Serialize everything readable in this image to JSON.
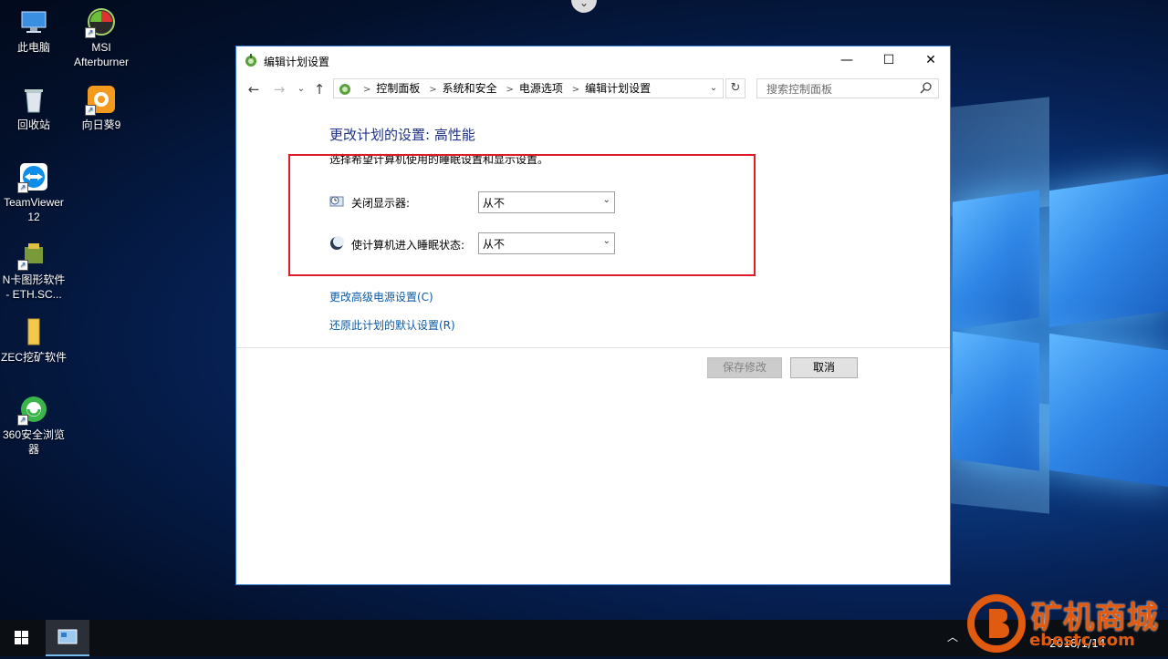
{
  "desktop": {
    "icons": [
      {
        "label": "此电脑"
      },
      {
        "label": "MSI Afterburner"
      },
      {
        "label": "回收站"
      },
      {
        "label": "向日葵9"
      },
      {
        "label": "TeamViewer 12"
      },
      {
        "label": "N卡图形软件 - ETH.SC..."
      },
      {
        "label": "ZEC挖矿软件"
      },
      {
        "label": "360安全浏览器"
      }
    ]
  },
  "window": {
    "title": "编辑计划设置",
    "controls": {
      "minimize": "—",
      "maximize": "☐",
      "close": "✕"
    },
    "breadcrumb": [
      "控制面板",
      "系统和安全",
      "电源选项",
      "编辑计划设置"
    ],
    "search_placeholder": "搜索控制面板",
    "heading": "更改计划的设置: 高性能",
    "subtext": "选择希望计算机使用的睡眠设置和显示设置。",
    "settings": [
      {
        "label": "关闭显示器:",
        "value": "从不"
      },
      {
        "label": "使计算机进入睡眠状态:",
        "value": "从不"
      }
    ],
    "links": [
      "更改高级电源设置(C)",
      "还原此计划的默认设置(R)"
    ],
    "buttons": {
      "save": "保存修改",
      "cancel": "取消"
    }
  },
  "taskbar": {
    "clock_time": "",
    "clock_date": "2018/1/14"
  },
  "watermark": {
    "text": "矿机商城",
    "url": "ebestc.com"
  },
  "colors": {
    "accent": "#3d7fd6",
    "heading": "#1e3287",
    "link": "#0b5aa6",
    "highlight_box": "#e01b24"
  }
}
